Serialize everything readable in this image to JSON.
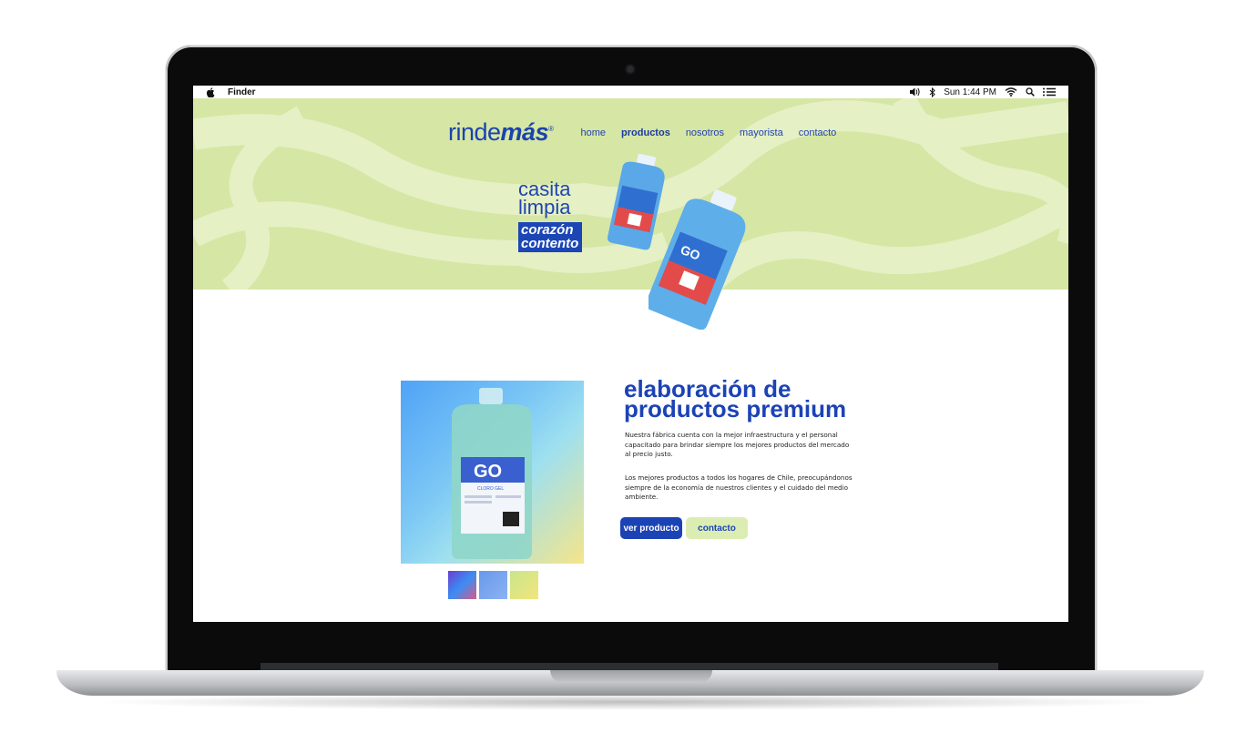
{
  "menubar": {
    "app_name": "Finder",
    "clock": "Sun 1:44 PM",
    "icons": [
      "apple-icon",
      "volume-icon",
      "bluetooth-icon",
      "wifi-icon",
      "search-icon",
      "list-icon"
    ]
  },
  "nav": {
    "logo_light": "rinde",
    "logo_bold": "más",
    "logo_mark": "®",
    "links": [
      "home",
      "productos",
      "nosotros",
      "mayorista",
      "contacto"
    ],
    "active": "productos"
  },
  "hero": {
    "tagline_light": [
      "casita",
      "limpia"
    ],
    "tagline_bold": [
      "corazón",
      "contento"
    ],
    "bg_color": "#d6e6a5"
  },
  "product": {
    "heading_line1": "elaboración de",
    "heading_line2": "productos premium",
    "paragraph1": "Nuestra fábrica cuenta con la mejor infraestructura y el personal capacitado para brindar siempre los mejores productos del mercado al precio justo.",
    "paragraph2": "Los mejores productos a todos los hogares de Chile, preocupándonos siempre de la economía de nuestros clientes y el cuidado del medio ambiente.",
    "button_primary": "ver producto",
    "button_secondary": "contacto",
    "bottle_brand": "GO",
    "bottle_label": "CLORO GEL"
  },
  "colors": {
    "brand_blue": "#1c43b5",
    "light_green": "#dcedb4"
  }
}
